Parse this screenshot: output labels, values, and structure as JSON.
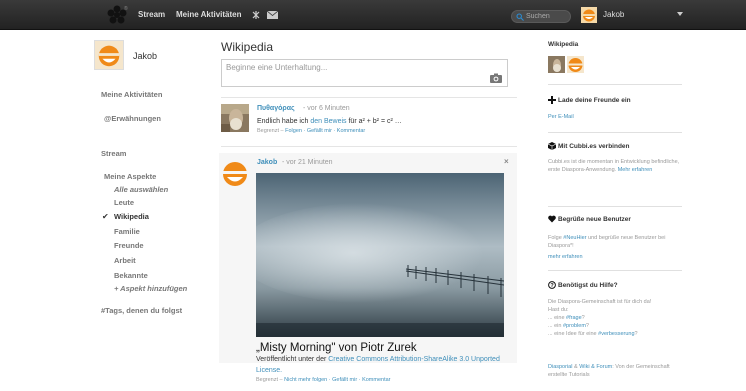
{
  "topbar": {
    "stream_label": "Stream",
    "activities_label": "Meine Aktivitäten",
    "search_placeholder": "Suchen",
    "user_name": "Jakob"
  },
  "sidebar": {
    "user_name": "Jakob",
    "my_activities": "Meine Aktivitäten",
    "mentions": "@Erwähnungen",
    "stream": "Stream",
    "my_aspects": "Meine Aspekte",
    "aspects": [
      "Alle auswählen",
      "Leute",
      "Wikipedia",
      "Familie",
      "Freunde",
      "Arbeit",
      "Bekannte",
      "+ Aspekt hinzufügen"
    ],
    "followed_tags": "#Tags, denen du folgst"
  },
  "main": {
    "title": "Wikipedia",
    "publisher_placeholder": "Beginne eine Unterhaltung...",
    "posts": [
      {
        "author": "Πυθαγόρας",
        "time": "- vor 6 Minuten",
        "text_pre": "Endlich habe ich ",
        "text_link": "den Beweis",
        "text_post": " für a² + b² = c² …",
        "meta_prefix": "Begrenzt – ",
        "meta_actions": "Folgen · Gefällt mir · Kommentar"
      },
      {
        "author": "Jakob",
        "time": "- vor 21 Minuten",
        "photo_title": "„Misty Morning\" von Piotr Zurek",
        "photo_sub_pre": "Veröffentlicht unter der ",
        "photo_sub_link": "Creative Commons Attribution-ShareAlike 3.0 Unported License.",
        "meta_prefix": "Begrenzt – ",
        "meta_actions": "Nicht mehr folgen · Gefällt mir · Kommentar"
      }
    ]
  },
  "right": {
    "aspect_title": "Wikipedia",
    "invite_title": "Lade deine Freunde ein",
    "invite_link": "Per E-Mail",
    "connect_title": "Mit Cubbi.es verbinden",
    "connect_text": "Cubbi.es ist die momentan in Entwicklung befindliche, erste Diaspora-Anwendung. ",
    "connect_link": "Mehr erfahren",
    "welcome_title": "Begrüße neue Benutzer",
    "welcome_pre": "Folge ",
    "welcome_tag": "#NeuHier",
    "welcome_post": " und begrüße neue Benutzer bei Diaspora*!",
    "welcome_link": "mehr erfahren",
    "help_title": "Benötigst du Hilfe?",
    "help_text1": "Die Diaspora-Gemeinschaft ist für dich da!",
    "help_text2": "Hast du:",
    "help_q_pre": "... eine ",
    "help_q_tag": "#frage",
    "help_q_post": "?",
    "help_p_pre": "... ein ",
    "help_p_tag": "#problem",
    "help_p_post": "?",
    "help_i_pre": "... eine Idee für eine ",
    "help_i_tag": "#verbesserung",
    "help_i_post": "?",
    "help_footer_link": "Diasporial",
    "help_footer_mid": " & ",
    "help_footer_link2": "Wiki & Forum",
    "help_footer_post": ": Von der Gemeinschaft erstellte Tutorials"
  }
}
